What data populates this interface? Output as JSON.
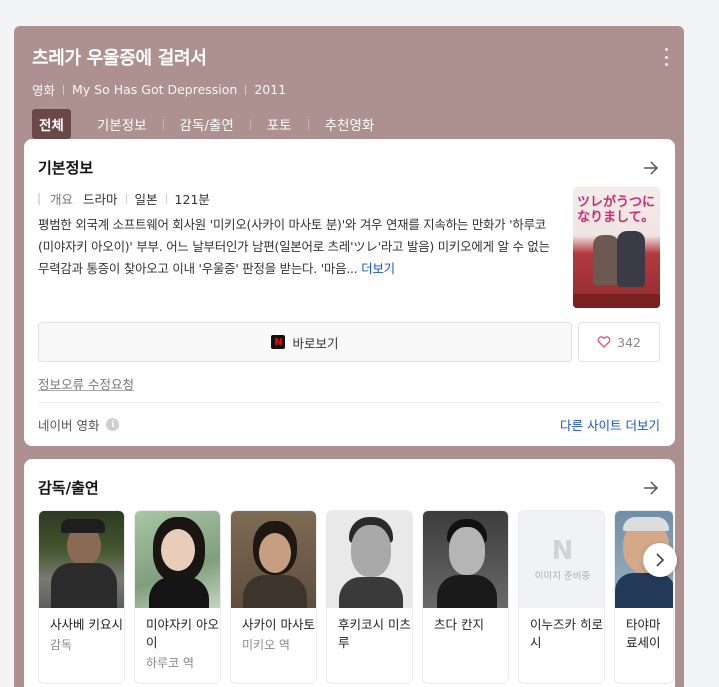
{
  "header": {
    "title": "츠레가 우울증에 걸려서",
    "meta": [
      "영화",
      "My So Has Got Depression",
      "2011"
    ],
    "tabs": [
      {
        "label": "전체",
        "active": true
      },
      {
        "label": "기본정보"
      },
      {
        "label": "감독/출연"
      },
      {
        "label": "포토"
      },
      {
        "label": "추천영화"
      }
    ],
    "more_icon": "more-vertical-icon"
  },
  "basic_info": {
    "section_title": "기본정보",
    "label": "개요",
    "genre": "드라마",
    "country": "일본",
    "runtime": "121분",
    "synopsis": "평범한 외국계 소프트웨어 회사원 '미키오(사카이 마사토 분)'와 겨우 연재를 지속하는 만화가 '하루코(미야자키 아오이)' 부부. 어느 날부터인가 남편(일본어로 츠레'ツレ'라고 발음) 미키오에게 알 수 없는 무력감과 통증이 찾아오고 이내 '우울증' 판정을 받는다. '마음... ",
    "more_link": "더보기",
    "poster_title": "ツレがうつになりまして。",
    "watch_label": "바로보기",
    "watch_icon": "N",
    "like_count": "342",
    "report_label": "정보오류 수정요청",
    "source_label": "네이버 영화",
    "info_icon": "i",
    "other_sites_label": "다른 사이트 더보기"
  },
  "cast": {
    "section_title": "감독/출연",
    "people": [
      {
        "name": "사사베 키요시",
        "role": "감독"
      },
      {
        "name": "미야자키 아오이",
        "role": "하루코 역"
      },
      {
        "name": "사카이 마사토",
        "role": "미키오 역"
      },
      {
        "name": "후키코시 미츠루",
        "role": ""
      },
      {
        "name": "츠다 칸지",
        "role": ""
      },
      {
        "name": "이누즈카 히로시",
        "role": "",
        "no_image": true
      },
      {
        "name": "타야마 료세이",
        "role": ""
      }
    ],
    "no_image_mark": "N",
    "no_image_text": "이미지 준비중"
  },
  "colors": {
    "header_bg": "#ad9090",
    "active_tab": "#6b4747",
    "link": "#1a53c9"
  }
}
